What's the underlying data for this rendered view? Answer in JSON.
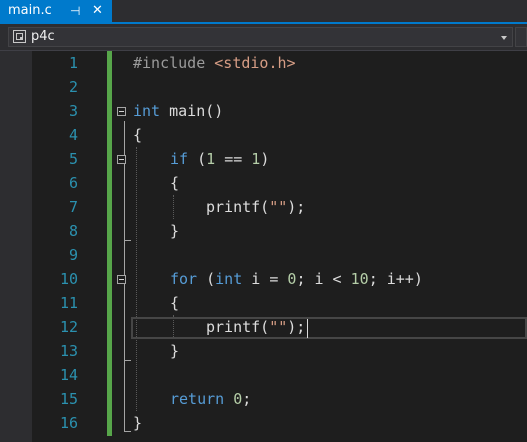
{
  "tab": {
    "title": "main.c",
    "pin_icon": "pin-icon",
    "close_icon": "close-icon"
  },
  "navbar": {
    "project": "p4c",
    "project_icon": "project-icon"
  },
  "line_numbers": [
    "1",
    "2",
    "3",
    "4",
    "5",
    "6",
    "7",
    "8",
    "9",
    "10",
    "11",
    "12",
    "13",
    "14",
    "15",
    "16"
  ],
  "code": {
    "l1": {
      "directive": "#include",
      "header": "<stdio.h>"
    },
    "l3": {
      "type": "int",
      "rest": "main()"
    },
    "l4": {
      "text": "{"
    },
    "l5": {
      "kw": "if",
      "open": "(",
      "a": "1",
      "op": "==",
      "b": "1",
      "close": ")"
    },
    "l6": {
      "text": "{"
    },
    "l7": {
      "fn": "printf(",
      "str": "\"\"",
      "end": ");"
    },
    "l8": {
      "text": "}"
    },
    "l10": {
      "kw": "for",
      "open": "(",
      "type": "int",
      "init": "i = ",
      "zero": "0",
      "cond": "; i < ",
      "ten": "10",
      "inc": "; i++)"
    },
    "l11": {
      "text": "{"
    },
    "l12": {
      "fn": "printf(",
      "str": "\"\"",
      "end": ");"
    },
    "l13": {
      "text": "}"
    },
    "l15": {
      "kw": "return",
      "zero": "0",
      "end": ";"
    },
    "l16": {
      "text": "}"
    }
  },
  "colors": {
    "accent": "#007acc",
    "keyword": "#569cd6",
    "string": "#d69d85",
    "number": "#b5cea8",
    "line_number": "#2b91af",
    "change_bar": "#57a64a"
  }
}
